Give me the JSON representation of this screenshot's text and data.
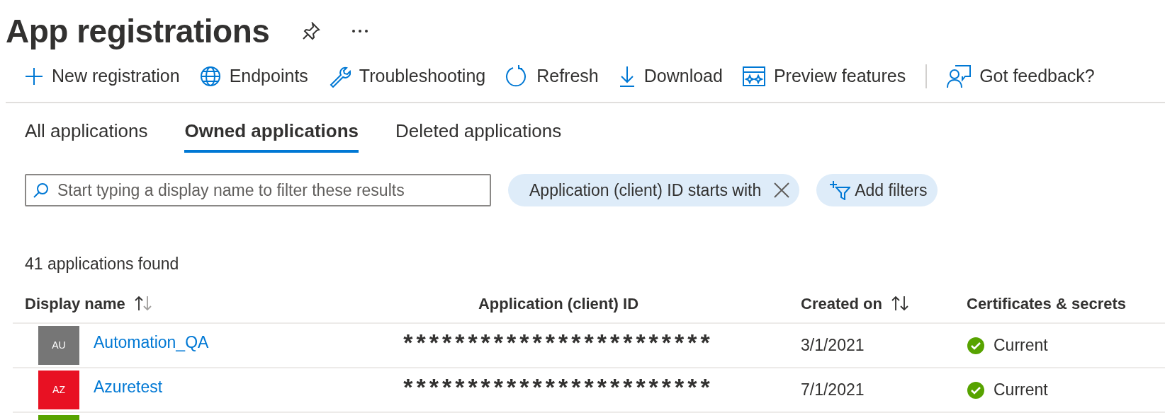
{
  "page": {
    "title": "App registrations"
  },
  "toolbar": [
    {
      "label": "New registration",
      "separator_before": false
    },
    {
      "label": "Endpoints",
      "separator_before": false
    },
    {
      "label": "Troubleshooting",
      "separator_before": false
    },
    {
      "label": "Refresh",
      "separator_before": false
    },
    {
      "label": "Download",
      "separator_before": false
    },
    {
      "label": "Preview features",
      "separator_before": false
    },
    {
      "label": "Got feedback?",
      "separator_before": true
    }
  ],
  "tabs": [
    {
      "label": "All applications",
      "selected": false
    },
    {
      "label": "Owned applications",
      "selected": true
    },
    {
      "label": "Deleted applications",
      "selected": false
    }
  ],
  "search": {
    "placeholder": "Start typing a display name to filter these results"
  },
  "filters": [
    {
      "label": "Application (client) ID starts with",
      "kind": "removable"
    },
    {
      "label": "Add filters",
      "kind": "add"
    }
  ],
  "result_count": "41 applications found",
  "table": {
    "columns": [
      {
        "label": "Display name",
        "sortable": true,
        "sorted_ascending": true
      },
      {
        "label": "Application (client) ID",
        "sortable": false
      },
      {
        "label": "Created on",
        "sortable": true,
        "sorted_ascending": false
      },
      {
        "label": "Certificates & secrets",
        "sortable": false
      }
    ],
    "rows": [
      {
        "initials": "AU",
        "color": "#767676",
        "name": "Automation_QA",
        "client_id": "************************",
        "created_on": "3/1/2021",
        "certificates": "Current"
      },
      {
        "initials": "AZ",
        "color": "#e81123",
        "name": "Azuretest",
        "client_id": "************************",
        "created_on": "7/1/2021",
        "certificates": "Current"
      },
      {
        "color": "#57a300"
      }
    ]
  }
}
